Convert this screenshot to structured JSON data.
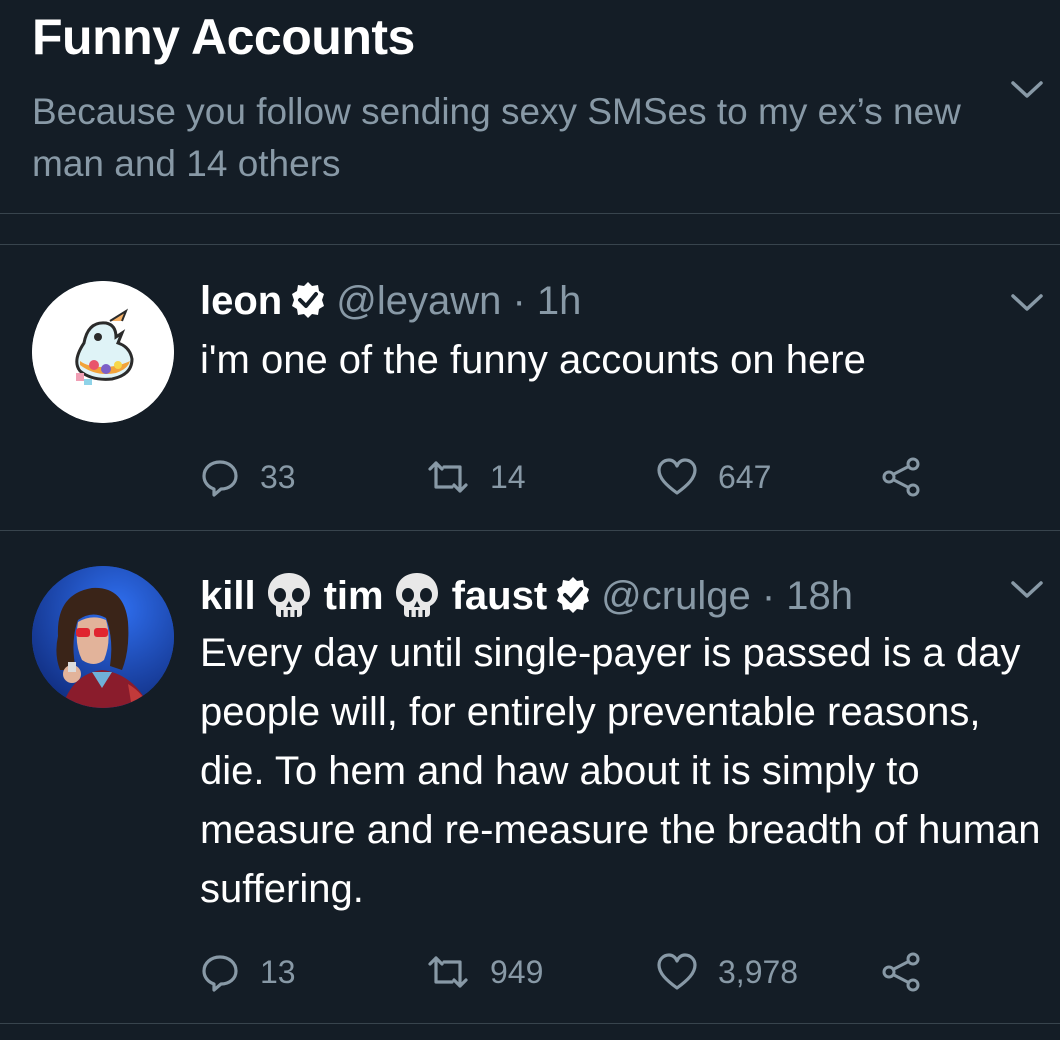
{
  "header": {
    "title": "Funny Accounts",
    "subtitle": "Because you follow sending sexy SMSes to my ex’s new man and 14 others"
  },
  "tweets": [
    {
      "name": "leon",
      "handle": "@leyawn",
      "time": "1h",
      "text": "i'm one of the funny accounts on here",
      "replies": "33",
      "retweets": "14",
      "likes": "647"
    },
    {
      "name_parts": [
        "kill",
        "tim",
        "faust"
      ],
      "handle": "@crulge",
      "time": "18h",
      "text": "Every day until single-payer is passed is a day people will, for entirely preventable reasons, die. To hem and haw about it is simply to measure and re-measure the breadth of human suffering.",
      "replies": "13",
      "retweets": "949",
      "likes": "3,978"
    }
  ],
  "separator": " · ",
  "colors": {
    "background": "#141d26",
    "secondary_text": "#8899a6",
    "divider": "#38444d",
    "verified_badge": "#ffffff"
  },
  "icons": [
    "chevron-down-icon",
    "verified-icon",
    "skull-icon",
    "reply-icon",
    "retweet-icon",
    "like-icon",
    "share-icon"
  ]
}
